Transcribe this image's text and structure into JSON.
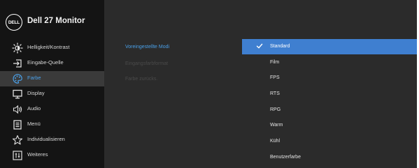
{
  "header": {
    "logo_text": "DELL",
    "title": "Dell 27 Monitor"
  },
  "sidebar": {
    "items": [
      {
        "label": "Helligkeit/Kontrast",
        "icon": "brightness-icon",
        "active": false
      },
      {
        "label": "Eingabe-Quelle",
        "icon": "input-source-icon",
        "active": false
      },
      {
        "label": "Farbe",
        "icon": "color-palette-icon",
        "active": true
      },
      {
        "label": "Display",
        "icon": "display-icon",
        "active": false
      },
      {
        "label": "Audio",
        "icon": "speaker-icon",
        "active": false
      },
      {
        "label": "Menü",
        "icon": "menu-icon",
        "active": false
      },
      {
        "label": "Individualisieren",
        "icon": "star-icon",
        "active": false
      },
      {
        "label": "Weiteres",
        "icon": "sliders-icon",
        "active": false
      }
    ]
  },
  "submenu": {
    "items": [
      {
        "label": "Voreingestellte Modi",
        "enabled": true
      },
      {
        "label": "Eingangsfarbformat",
        "enabled": false
      },
      {
        "label": "Farbe zurücks.",
        "enabled": false
      }
    ]
  },
  "options": {
    "items": [
      {
        "label": "Standard",
        "selected": true
      },
      {
        "label": "Film",
        "selected": false
      },
      {
        "label": "FPS",
        "selected": false
      },
      {
        "label": "RTS",
        "selected": false
      },
      {
        "label": "RPG",
        "selected": false
      },
      {
        "label": "Warm",
        "selected": false
      },
      {
        "label": "Kühl",
        "selected": false
      },
      {
        "label": "Benutzerfarbe",
        "selected": false
      }
    ]
  },
  "colors": {
    "accent": "#4aa0e8",
    "selected_bg": "#3f7fd0",
    "panel_bg": "#2b2b2b",
    "sidebar_bg": "#141414"
  }
}
